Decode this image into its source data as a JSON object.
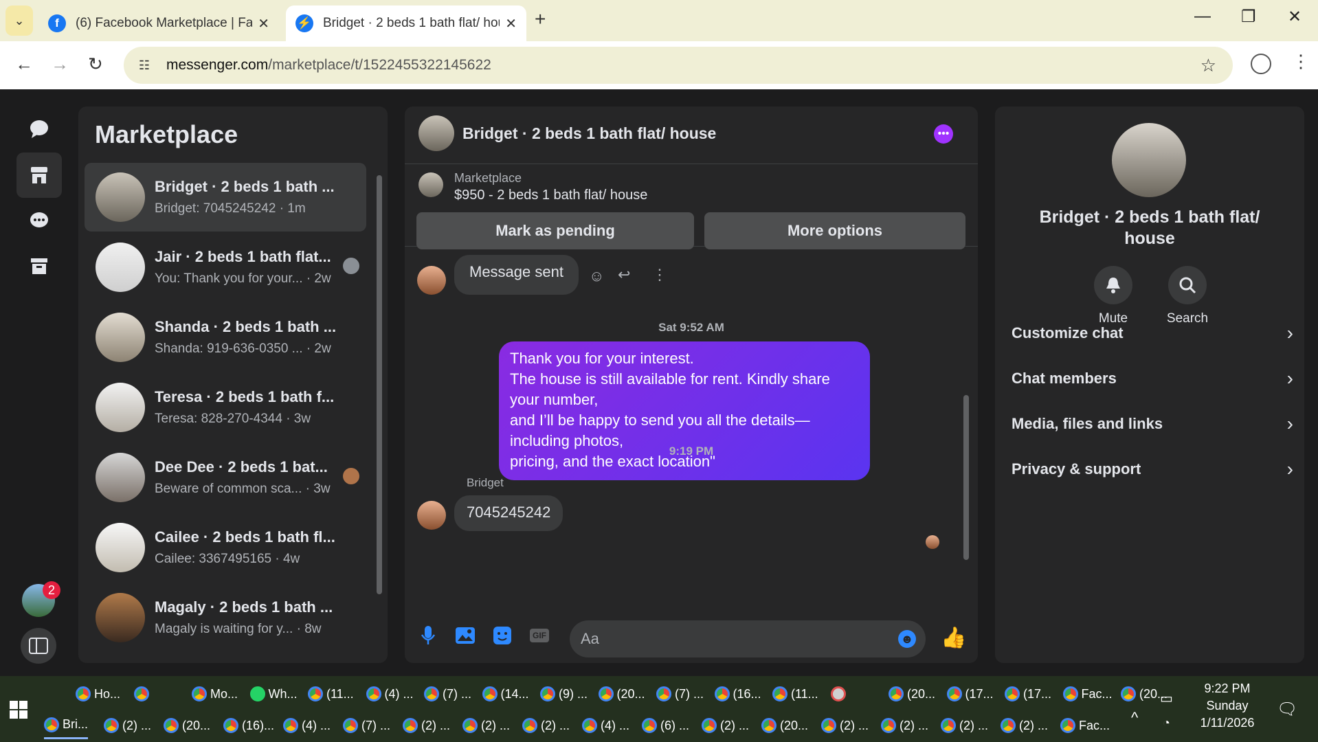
{
  "browser": {
    "tabs": [
      {
        "title": "(6) Facebook Marketplace | Face",
        "icon": "facebook-icon"
      },
      {
        "title": "Bridget · 2 beds 1 bath flat/ hou",
        "icon": "messenger-icon"
      }
    ],
    "url_domain": "messenger.com",
    "url_path": "/marketplace/t/1522455322145622"
  },
  "sidebar": {
    "title": "Marketplace",
    "notification_count": "2"
  },
  "conversations": [
    {
      "name": "Bridget · 2 beds 1 bath ...",
      "preview": "Bridget: 7045245242 · 1m"
    },
    {
      "name": "Jair · 2 beds 1 bath flat...",
      "preview": "You: Thank you for your... · 2w"
    },
    {
      "name": "Shanda · 2 beds 1 bath ...",
      "preview": "Shanda: 919-636-0350 ... · 2w"
    },
    {
      "name": "Teresa · 2 beds 1 bath f...",
      "preview": "Teresa: 828-270-4344 · 3w"
    },
    {
      "name": "Dee Dee · 2 beds 1 bat...",
      "preview": "Beware of common sca... · 3w"
    },
    {
      "name": "Cailee · 2 beds 1 bath fl...",
      "preview": "Cailee: 3367495165 · 4w"
    },
    {
      "name": "Magaly · 2 beds 1 bath ...",
      "preview": "Magaly is waiting for y... · 8w"
    }
  ],
  "chat": {
    "title": "Bridget · 2 beds 1 bath flat/ house",
    "listing_label": "Marketplace",
    "listing_price": "$950 - 2 beds 1 bath flat/ house",
    "mark_pending": "Mark as pending",
    "more_options": "More options",
    "msg_sent": "Message sent",
    "ts1": "Sat 9:52 AM",
    "sent_lines": [
      "Thank you for your interest.",
      "The house is still available for rent. Kindly share your number,",
      "and I’ll be happy to send you all the details—including photos,",
      "pricing, and the exact location\""
    ],
    "ts2": "9:19 PM",
    "sender": "Bridget",
    "reply": "7045245242",
    "placeholder": "Aa",
    "gif": "GIF"
  },
  "details": {
    "name_l1": "Bridget · 2 beds 1 bath flat/",
    "name_l2": "house",
    "mute": "Mute",
    "search": "Search",
    "items": [
      "Customize chat",
      "Chat members",
      "Media, files and links",
      "Privacy & support"
    ]
  },
  "taskbar": {
    "row1": [
      "Ho...",
      "",
      "Mo...",
      "Wh...",
      "(11...",
      "(4) ...",
      "(7) ...",
      "(14...",
      "(9) ...",
      "(20...",
      "(7) ...",
      "(16...",
      "(11...",
      "",
      "(20...",
      "(17...",
      "(17...",
      "Fac...",
      "(20..."
    ],
    "row2": [
      "Bri...",
      "(2) ...",
      "(20...",
      "(16)...",
      "(4) ...",
      "(7) ...",
      "(2) ...",
      "(2) ...",
      "(2) ...",
      "(4) ...",
      "(6) ...",
      "(2) ...",
      "(20...",
      "(2) ...",
      "(2) ...",
      "(2) ...",
      "(2) ...",
      "Fac..."
    ],
    "time": "9:22 PM",
    "day": "Sunday",
    "date": "1/11/2026"
  }
}
